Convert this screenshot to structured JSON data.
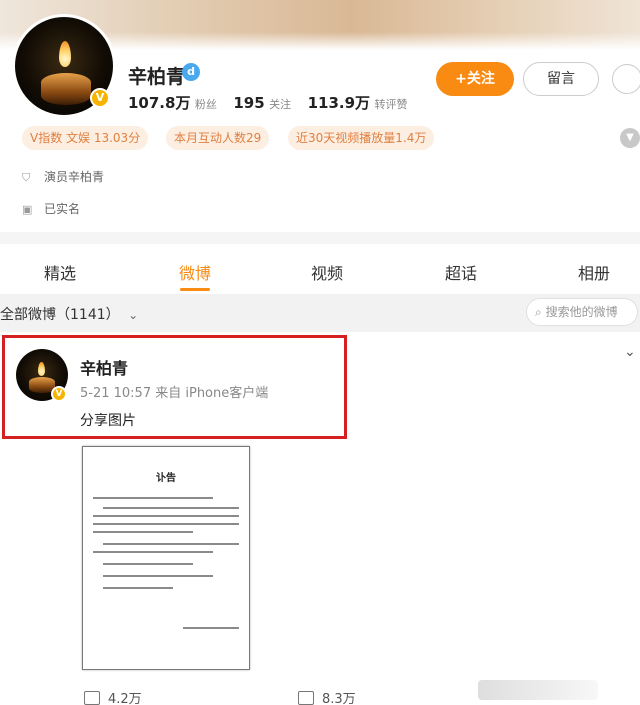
{
  "profile": {
    "name": "辛柏青",
    "vip_badge": "V",
    "verify_mark": "d",
    "stats": {
      "fans_value": "107.8万",
      "fans_label": "粉丝",
      "following_value": "195",
      "following_label": "关注",
      "reposts_value": "113.9万",
      "reposts_label": "转评赞"
    },
    "follow_label": "+关注",
    "message_label": "留言",
    "tags": [
      "V指数 文娱 13.03分",
      "本月互动人数29",
      "近30天视频播放量1.4万"
    ],
    "info": [
      {
        "icon": "shield-icon",
        "text": "演员辛柏青"
      },
      {
        "icon": "id-card-icon",
        "text": "已实名"
      }
    ]
  },
  "tabs": [
    "精选",
    "微博",
    "视频",
    "超话",
    "相册"
  ],
  "active_tab": "微博",
  "filter": {
    "label": "全部微博（1141）",
    "search_placeholder": "搜索他的微博"
  },
  "post": {
    "author": "辛柏青",
    "meta": "5-21 10:57  来自 iPhone客户端",
    "text": "分享图片",
    "image_title": "讣告",
    "actions": [
      {
        "icon": "share-icon",
        "count": "4.2万"
      },
      {
        "icon": "comment-icon",
        "count": "8.3万"
      }
    ]
  },
  "colors": {
    "accent": "#f98a12",
    "highlight_border": "#d42020",
    "verify_blue": "#4aa8ee",
    "tag_bg": "#fdeee2"
  }
}
